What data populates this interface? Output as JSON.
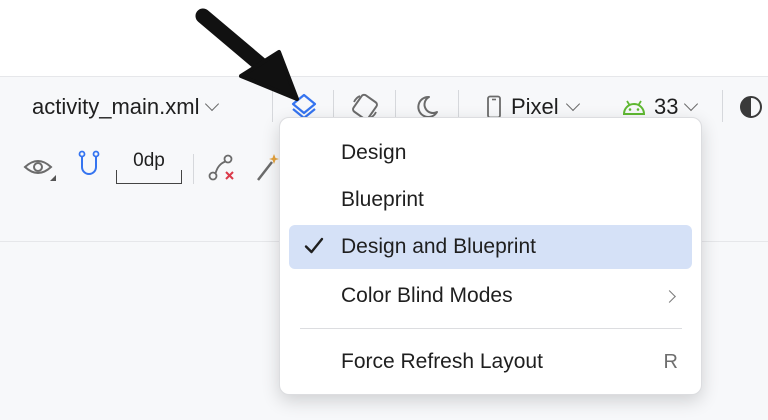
{
  "toolbar": {
    "file_name": "activity_main.xml",
    "device_label": "Pixel",
    "api_level": "33",
    "margin_value": "0dp"
  },
  "menu": {
    "items": [
      {
        "label": "Design",
        "checked": false
      },
      {
        "label": "Blueprint",
        "checked": false
      },
      {
        "label": "Design and Blueprint",
        "checked": true
      },
      {
        "label": "Color Blind Modes",
        "submenu": true
      },
      {
        "label": "Force Refresh Layout",
        "shortcut": "R"
      }
    ]
  },
  "colors": {
    "accent": "#3574f0",
    "selected_bg": "#d5e1f7",
    "android_green": "#5fb832",
    "error_red": "#db3b4b"
  },
  "icons": [
    "black-arrow-annotation-icon",
    "design-surface-icon",
    "orientation-icon",
    "night-mode-icon",
    "phone-device-icon",
    "android-icon",
    "theme-contrast-icon",
    "eye-icon",
    "magnet-icon",
    "constraint-clear-icon",
    "magic-wand-icon",
    "checkmark-icon"
  ]
}
